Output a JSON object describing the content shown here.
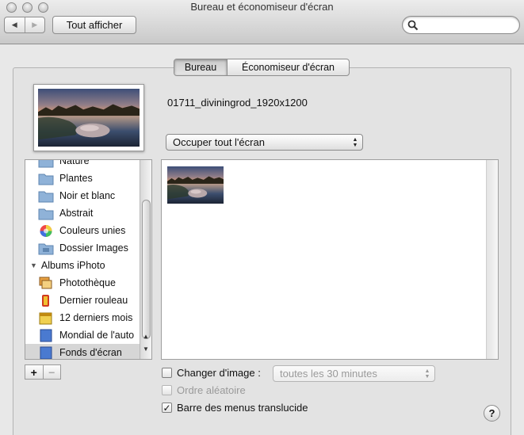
{
  "window": {
    "title": "Bureau et économiseur d'écran"
  },
  "toolbar": {
    "back_glyph": "◀",
    "forward_glyph": "▶",
    "show_all_label": "Tout afficher",
    "search_placeholder": ""
  },
  "tabs": [
    {
      "label": "Bureau",
      "selected": true
    },
    {
      "label": "Économiseur d'écran",
      "selected": false
    }
  ],
  "desktop": {
    "current_image_name": "01711_diviningrod_1920x1200",
    "fill_mode": "Occuper tout l'écran"
  },
  "sidebar": {
    "items": [
      {
        "label": "Nature",
        "icon": "folder-icon",
        "type": "folder"
      },
      {
        "label": "Plantes",
        "icon": "folder-icon",
        "type": "folder"
      },
      {
        "label": "Noir et blanc",
        "icon": "folder-icon",
        "type": "folder"
      },
      {
        "label": "Abstrait",
        "icon": "folder-icon",
        "type": "folder"
      },
      {
        "label": "Couleurs unies",
        "icon": "color-wheel-icon",
        "type": "colors"
      },
      {
        "label": "Dossier Images",
        "icon": "pictures-folder-icon",
        "type": "folder"
      },
      {
        "label": "Albums iPhoto",
        "icon": "disclosure-triangle-icon",
        "type": "header"
      },
      {
        "label": "Photothèque",
        "icon": "photo-library-icon",
        "type": "library"
      },
      {
        "label": "Dernier rouleau",
        "icon": "film-roll-icon",
        "type": "roll"
      },
      {
        "label": "12 derniers mois",
        "icon": "calendar-icon",
        "type": "calendar"
      },
      {
        "label": "Mondial de l'auto",
        "icon": "album-icon",
        "type": "album"
      },
      {
        "label": "Fonds d'écran",
        "icon": "album-icon",
        "type": "album",
        "selected": true
      }
    ],
    "add_label": "+",
    "remove_label": "−"
  },
  "options": {
    "change_image_label": "Changer d'image :",
    "change_image_checked": false,
    "interval": "toutes les 30 minutes",
    "random_order_label": "Ordre aléatoire",
    "random_order_checked": false,
    "translucent_menu_label": "Barre des menus translucide",
    "translucent_menu_checked": true,
    "checkmark": "✓"
  },
  "help_label": "?",
  "colors": {
    "selected_row": "#d6d6d6",
    "disabled_text": "#9a9a9a"
  }
}
